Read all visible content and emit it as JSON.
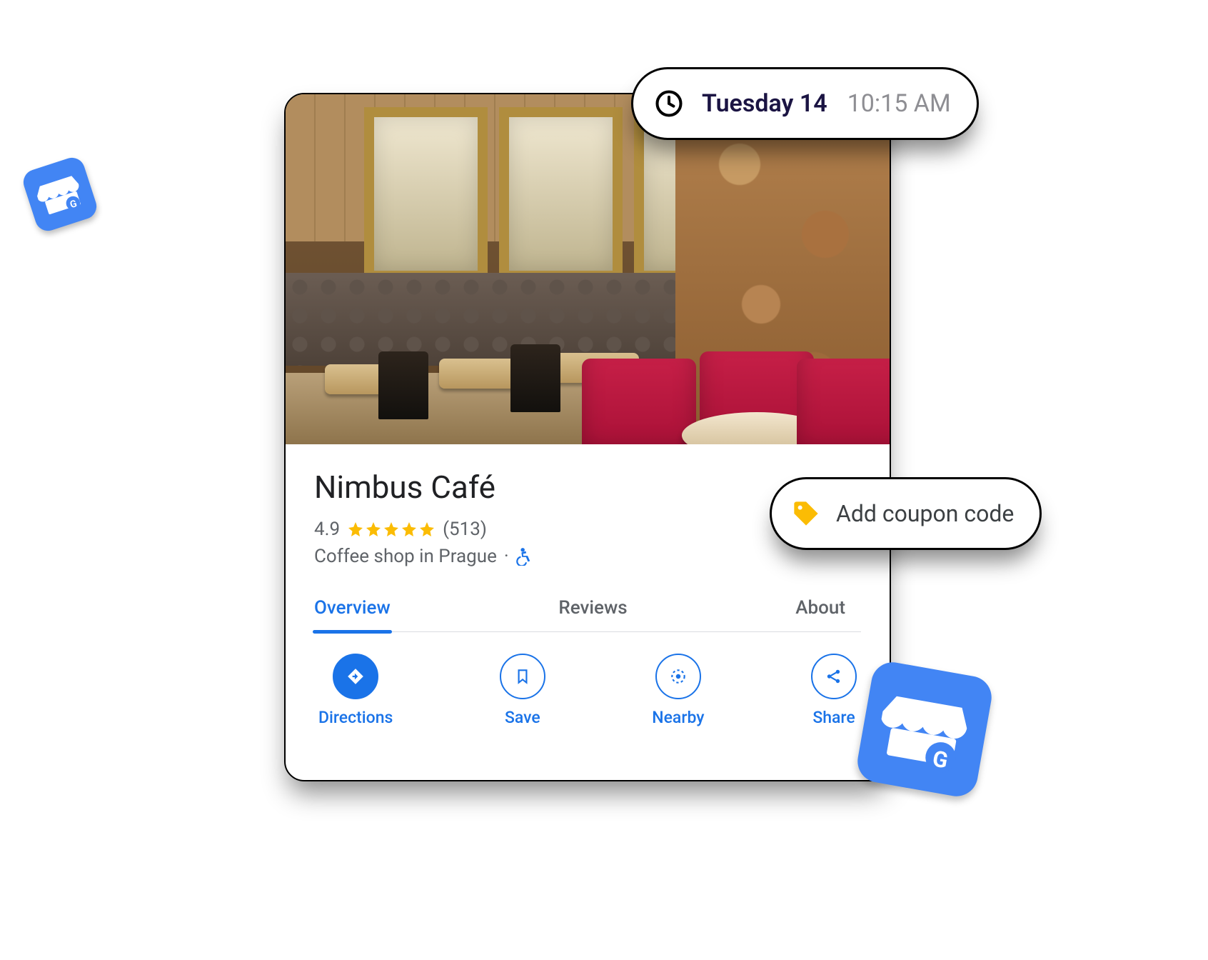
{
  "floatingTime": {
    "day": "Tuesday 14",
    "time": "10:15 AM"
  },
  "floatingCoupon": {
    "label": "Add coupon code"
  },
  "listing": {
    "title": "Nimbus Café",
    "rating_value": "4.9",
    "rating_count": "(513)",
    "category_line": "Coffee shop in Prague",
    "separator": "·"
  },
  "tabs": [
    {
      "label": "Overview",
      "active": true
    },
    {
      "label": "Reviews",
      "active": false
    },
    {
      "label": "About",
      "active": false
    }
  ],
  "actions": [
    {
      "label": "Directions",
      "icon": "turn-right-icon",
      "primary": true
    },
    {
      "label": "Save",
      "icon": "bookmark-icon",
      "primary": false
    },
    {
      "label": "Nearby",
      "icon": "location-icon",
      "primary": false
    },
    {
      "label": "Share",
      "icon": "share-icon",
      "primary": false
    }
  ],
  "colors": {
    "google_blue": "#1a73e8",
    "star_yellow": "#fbbc04",
    "tile_blue": "#4285f4"
  }
}
